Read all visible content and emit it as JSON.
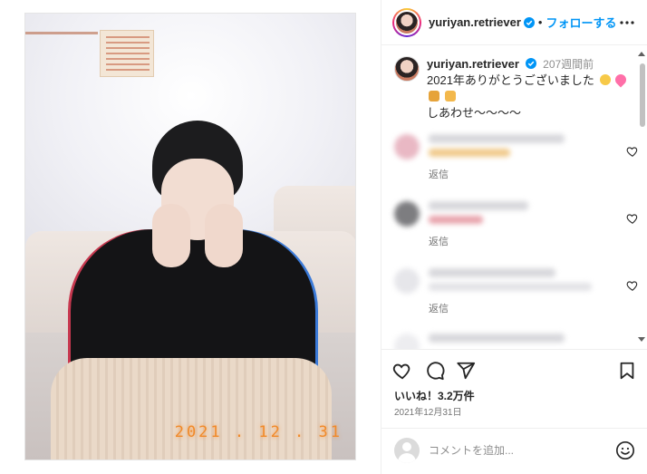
{
  "post": {
    "photo_date_stamp": "2021 . 12 . 31"
  },
  "header": {
    "username": "yuriyan.retriever",
    "separator": "•",
    "follow_label": "フォローする"
  },
  "caption": {
    "username": "yuriyan.retriever",
    "time_ago": "207週間前",
    "line1": "2021年ありがとうございました",
    "line3": "しあわせ〜〜〜〜"
  },
  "comments": [
    {
      "reply_label": "返信"
    },
    {
      "reply_label": "返信"
    },
    {
      "reply_label": "返信"
    }
  ],
  "actions": {
    "likes_text": "いいね！3.2万件",
    "date_text": "2021年12月31日"
  },
  "comment_box": {
    "placeholder": "コメントを追加..."
  },
  "colors": {
    "accent": "#0095f6",
    "verified": "#0095f6",
    "date_stamp": "#f08a2a"
  },
  "icons": [
    "verified-icon",
    "more-icon",
    "heart-icon",
    "comment-icon",
    "share-icon",
    "bookmark-icon",
    "emoji-icon",
    "scroll-up-icon",
    "scroll-down-icon"
  ]
}
